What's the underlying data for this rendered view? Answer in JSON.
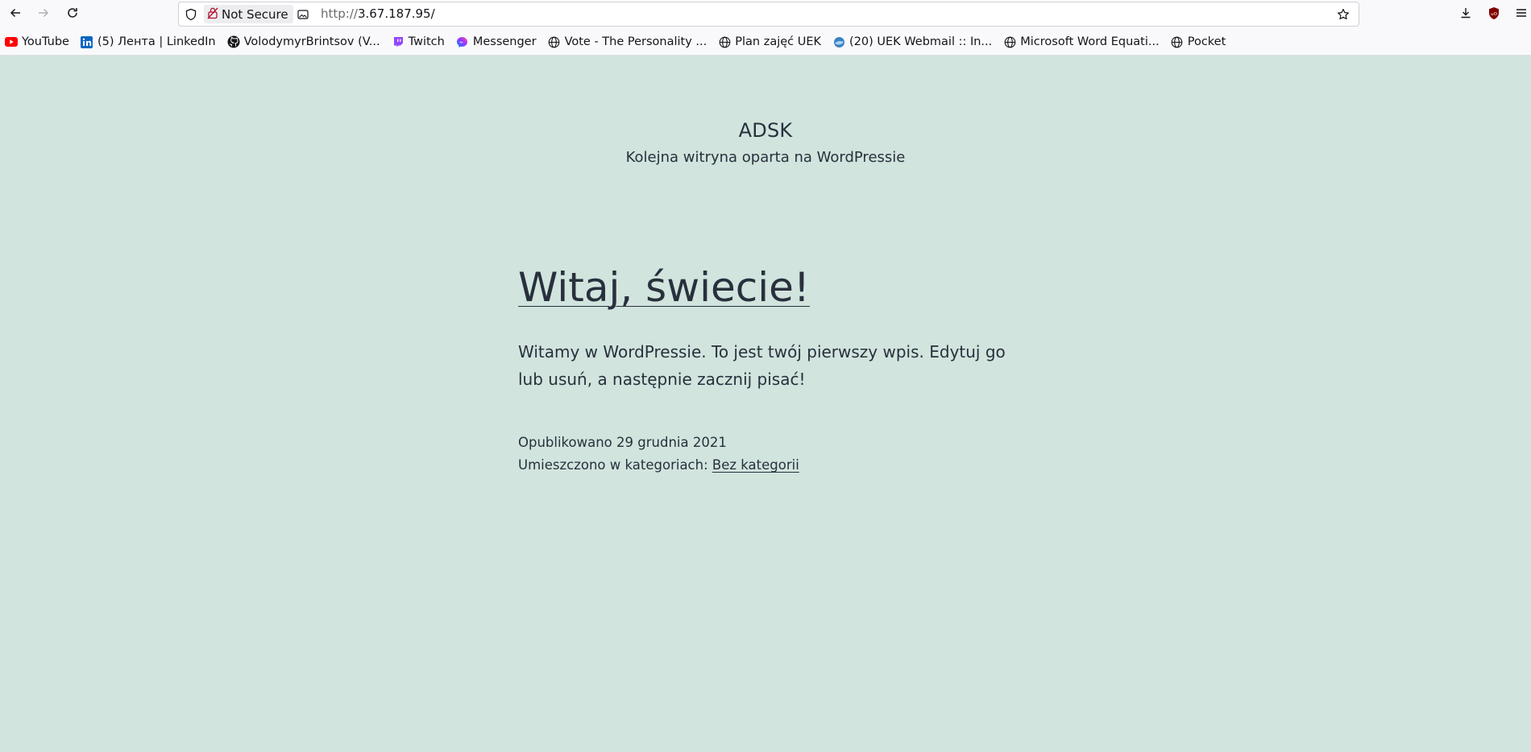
{
  "browser": {
    "security_label": "Not Secure",
    "url_protocol": "http://",
    "url_host": "3.67.187.95/",
    "bookmarks": [
      {
        "label": "YouTube",
        "icon": "youtube-icon"
      },
      {
        "label": "(5) Лента | LinkedIn",
        "icon": "linkedin-icon"
      },
      {
        "label": "VolodymyrBrintsov (V...",
        "icon": "github-icon"
      },
      {
        "label": "Twitch",
        "icon": "twitch-icon"
      },
      {
        "label": "Messenger",
        "icon": "messenger-icon"
      },
      {
        "label": "Vote - The Personality ...",
        "icon": "globe-icon"
      },
      {
        "label": "Plan zajęć UEK",
        "icon": "globe-icon"
      },
      {
        "label": "(20) UEK Webmail :: In...",
        "icon": "webmail-icon"
      },
      {
        "label": "Microsoft Word Equati...",
        "icon": "globe-icon"
      },
      {
        "label": "Pocket",
        "icon": "globe-icon"
      }
    ],
    "colors": {
      "youtube": "#ff0000",
      "linkedin": "#0a66c2",
      "twitch": "#9146ff",
      "ublock": "#800000"
    }
  },
  "site": {
    "title": "ADSK",
    "description": "Kolejna witryna oparta na WordPressie",
    "background": "#d1e4dd"
  },
  "post": {
    "title": "Witaj, świecie!",
    "content": "Witamy w WordPressie. To jest twój pierwszy wpis. Edytuj go lub usuń, a następnie zacznij pisać!",
    "published": "Opublikowano 29 grudnia 2021",
    "categories_label": "Umieszczono w kategoriach: ",
    "category": "Bez kategorii"
  }
}
